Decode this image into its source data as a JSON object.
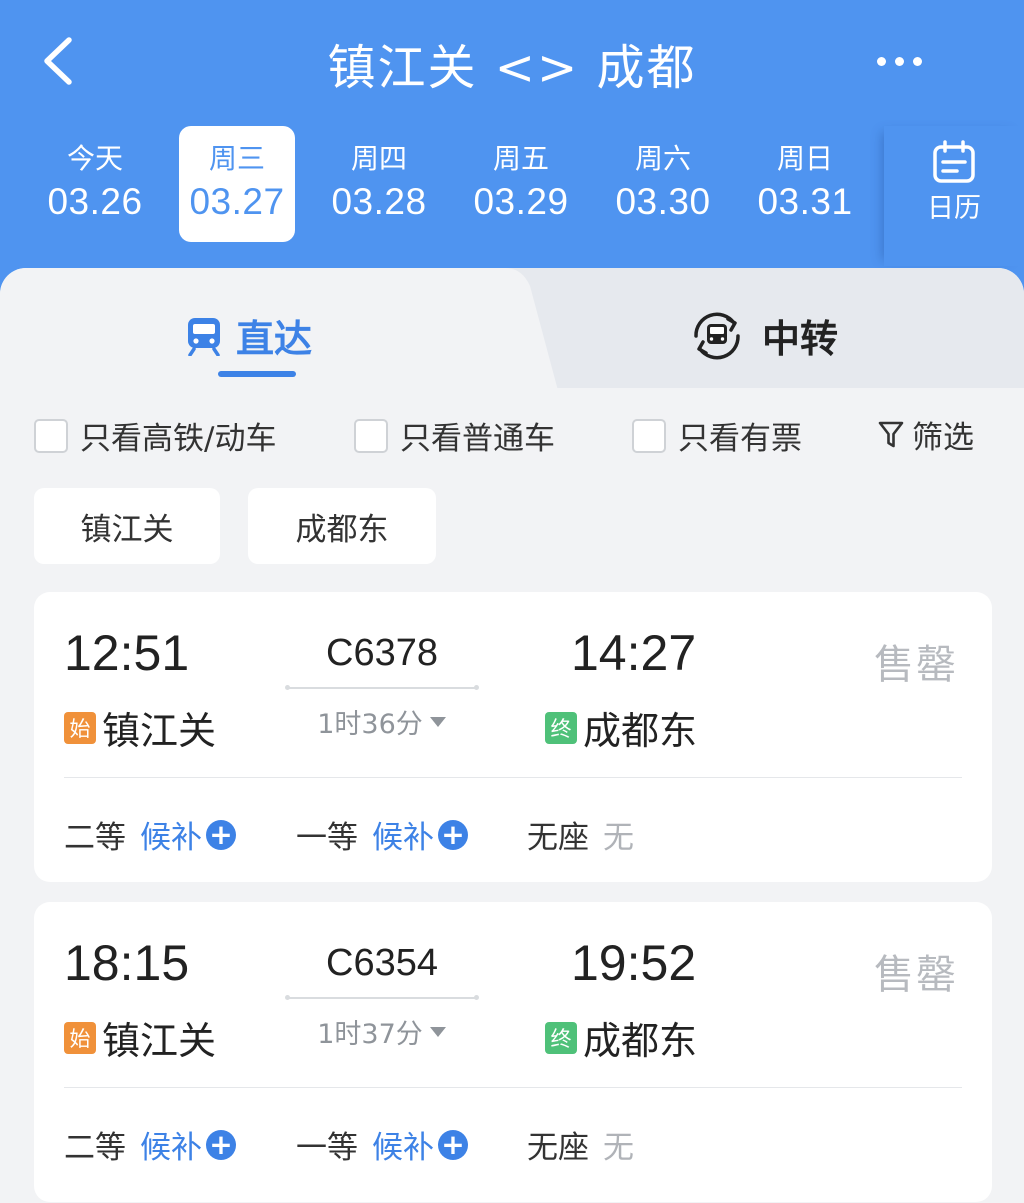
{
  "header": {
    "title": "镇江关 <> 成都",
    "back_icon": "chevron-left-icon",
    "more_icon": "more-dots-icon",
    "background_color": "#4f94f0"
  },
  "dates": [
    {
      "weekday": "今天",
      "date": "03.26",
      "active": false
    },
    {
      "weekday": "周三",
      "date": "03.27",
      "active": true
    },
    {
      "weekday": "周四",
      "date": "03.28",
      "active": false
    },
    {
      "weekday": "周五",
      "date": "03.29",
      "active": false
    },
    {
      "weekday": "周六",
      "date": "03.30",
      "active": false
    },
    {
      "weekday": "周日",
      "date": "03.31",
      "active": false
    }
  ],
  "calendar": {
    "label": "日历",
    "icon": "calendar-icon"
  },
  "tabs": [
    {
      "label": "直达",
      "icon": "train-icon",
      "active": true
    },
    {
      "label": "中转",
      "icon": "transfer-train-icon",
      "active": false
    }
  ],
  "filters": [
    {
      "label": "只看高铁/动车",
      "checked": false
    },
    {
      "label": "只看普通车",
      "checked": false
    },
    {
      "label": "只看有票",
      "checked": false
    }
  ],
  "screen": {
    "label": "筛选",
    "icon": "filter-funnel-icon"
  },
  "stations": [
    "镇江关",
    "成都东"
  ],
  "trains": [
    {
      "depart_time": "12:51",
      "train_no": "C6378",
      "duration": "1时36分",
      "arrive_time": "14:27",
      "from_badge": "始",
      "from_station": "镇江关",
      "to_badge": "终",
      "to_station": "成都东",
      "status": "售罄",
      "seats": {
        "second_label": "二等",
        "second_action": "候补",
        "first_label": "一等",
        "first_action": "候补",
        "standing_label": "无座",
        "standing_value": "无"
      }
    },
    {
      "depart_time": "18:15",
      "train_no": "C6354",
      "duration": "1时37分",
      "arrive_time": "19:52",
      "from_badge": "始",
      "from_station": "镇江关",
      "to_badge": "终",
      "to_station": "成都东",
      "status": "售罄",
      "seats": {
        "second_label": "二等",
        "second_action": "候补",
        "first_label": "一等",
        "first_action": "候补",
        "standing_label": "无座",
        "standing_value": "无"
      }
    }
  ]
}
